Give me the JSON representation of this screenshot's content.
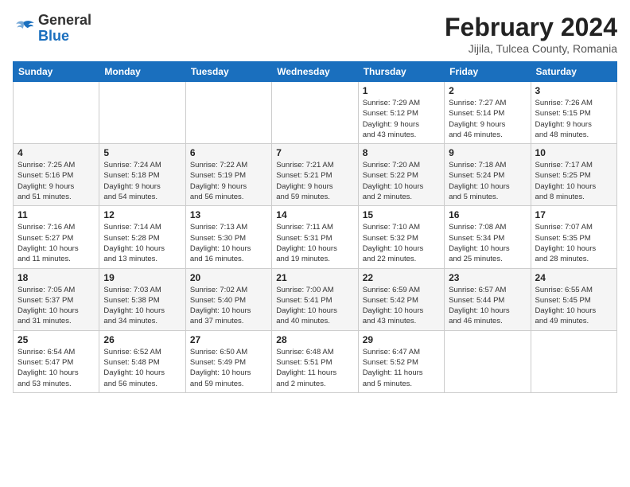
{
  "header": {
    "logo_general": "General",
    "logo_blue": "Blue",
    "month_year": "February 2024",
    "location": "Jijila, Tulcea County, Romania"
  },
  "days_of_week": [
    "Sunday",
    "Monday",
    "Tuesday",
    "Wednesday",
    "Thursday",
    "Friday",
    "Saturday"
  ],
  "weeks": [
    [
      {
        "day": "",
        "info": ""
      },
      {
        "day": "",
        "info": ""
      },
      {
        "day": "",
        "info": ""
      },
      {
        "day": "",
        "info": ""
      },
      {
        "day": "1",
        "info": "Sunrise: 7:29 AM\nSunset: 5:12 PM\nDaylight: 9 hours\nand 43 minutes."
      },
      {
        "day": "2",
        "info": "Sunrise: 7:27 AM\nSunset: 5:14 PM\nDaylight: 9 hours\nand 46 minutes."
      },
      {
        "day": "3",
        "info": "Sunrise: 7:26 AM\nSunset: 5:15 PM\nDaylight: 9 hours\nand 48 minutes."
      }
    ],
    [
      {
        "day": "4",
        "info": "Sunrise: 7:25 AM\nSunset: 5:16 PM\nDaylight: 9 hours\nand 51 minutes."
      },
      {
        "day": "5",
        "info": "Sunrise: 7:24 AM\nSunset: 5:18 PM\nDaylight: 9 hours\nand 54 minutes."
      },
      {
        "day": "6",
        "info": "Sunrise: 7:22 AM\nSunset: 5:19 PM\nDaylight: 9 hours\nand 56 minutes."
      },
      {
        "day": "7",
        "info": "Sunrise: 7:21 AM\nSunset: 5:21 PM\nDaylight: 9 hours\nand 59 minutes."
      },
      {
        "day": "8",
        "info": "Sunrise: 7:20 AM\nSunset: 5:22 PM\nDaylight: 10 hours\nand 2 minutes."
      },
      {
        "day": "9",
        "info": "Sunrise: 7:18 AM\nSunset: 5:24 PM\nDaylight: 10 hours\nand 5 minutes."
      },
      {
        "day": "10",
        "info": "Sunrise: 7:17 AM\nSunset: 5:25 PM\nDaylight: 10 hours\nand 8 minutes."
      }
    ],
    [
      {
        "day": "11",
        "info": "Sunrise: 7:16 AM\nSunset: 5:27 PM\nDaylight: 10 hours\nand 11 minutes."
      },
      {
        "day": "12",
        "info": "Sunrise: 7:14 AM\nSunset: 5:28 PM\nDaylight: 10 hours\nand 13 minutes."
      },
      {
        "day": "13",
        "info": "Sunrise: 7:13 AM\nSunset: 5:30 PM\nDaylight: 10 hours\nand 16 minutes."
      },
      {
        "day": "14",
        "info": "Sunrise: 7:11 AM\nSunset: 5:31 PM\nDaylight: 10 hours\nand 19 minutes."
      },
      {
        "day": "15",
        "info": "Sunrise: 7:10 AM\nSunset: 5:32 PM\nDaylight: 10 hours\nand 22 minutes."
      },
      {
        "day": "16",
        "info": "Sunrise: 7:08 AM\nSunset: 5:34 PM\nDaylight: 10 hours\nand 25 minutes."
      },
      {
        "day": "17",
        "info": "Sunrise: 7:07 AM\nSunset: 5:35 PM\nDaylight: 10 hours\nand 28 minutes."
      }
    ],
    [
      {
        "day": "18",
        "info": "Sunrise: 7:05 AM\nSunset: 5:37 PM\nDaylight: 10 hours\nand 31 minutes."
      },
      {
        "day": "19",
        "info": "Sunrise: 7:03 AM\nSunset: 5:38 PM\nDaylight: 10 hours\nand 34 minutes."
      },
      {
        "day": "20",
        "info": "Sunrise: 7:02 AM\nSunset: 5:40 PM\nDaylight: 10 hours\nand 37 minutes."
      },
      {
        "day": "21",
        "info": "Sunrise: 7:00 AM\nSunset: 5:41 PM\nDaylight: 10 hours\nand 40 minutes."
      },
      {
        "day": "22",
        "info": "Sunrise: 6:59 AM\nSunset: 5:42 PM\nDaylight: 10 hours\nand 43 minutes."
      },
      {
        "day": "23",
        "info": "Sunrise: 6:57 AM\nSunset: 5:44 PM\nDaylight: 10 hours\nand 46 minutes."
      },
      {
        "day": "24",
        "info": "Sunrise: 6:55 AM\nSunset: 5:45 PM\nDaylight: 10 hours\nand 49 minutes."
      }
    ],
    [
      {
        "day": "25",
        "info": "Sunrise: 6:54 AM\nSunset: 5:47 PM\nDaylight: 10 hours\nand 53 minutes."
      },
      {
        "day": "26",
        "info": "Sunrise: 6:52 AM\nSunset: 5:48 PM\nDaylight: 10 hours\nand 56 minutes."
      },
      {
        "day": "27",
        "info": "Sunrise: 6:50 AM\nSunset: 5:49 PM\nDaylight: 10 hours\nand 59 minutes."
      },
      {
        "day": "28",
        "info": "Sunrise: 6:48 AM\nSunset: 5:51 PM\nDaylight: 11 hours\nand 2 minutes."
      },
      {
        "day": "29",
        "info": "Sunrise: 6:47 AM\nSunset: 5:52 PM\nDaylight: 11 hours\nand 5 minutes."
      },
      {
        "day": "",
        "info": ""
      },
      {
        "day": "",
        "info": ""
      }
    ]
  ]
}
